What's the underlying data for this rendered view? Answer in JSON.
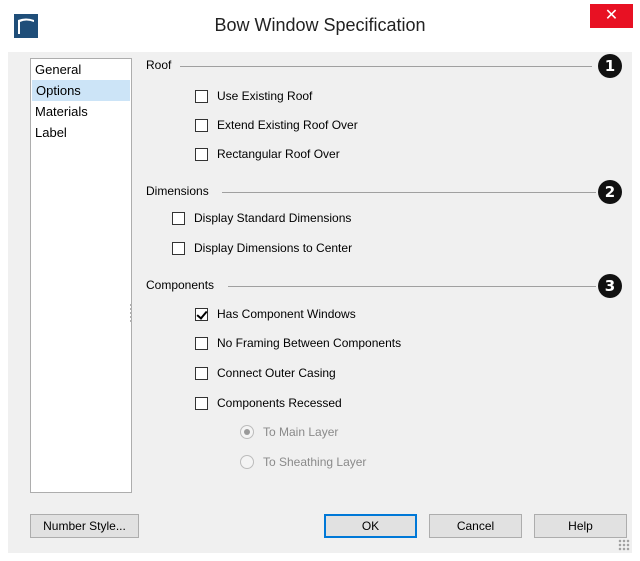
{
  "window": {
    "title": "Bow Window Specification",
    "close_glyph": "✕"
  },
  "nav": {
    "items": [
      {
        "label": "General",
        "selected": false
      },
      {
        "label": "Options",
        "selected": true
      },
      {
        "label": "Materials",
        "selected": false
      },
      {
        "label": "Label",
        "selected": false
      }
    ]
  },
  "sections": {
    "roof": {
      "label": "Roof",
      "badge": "1",
      "options": [
        {
          "label": "Use Existing Roof",
          "checked": false
        },
        {
          "label": "Extend Existing Roof Over",
          "checked": false
        },
        {
          "label": "Rectangular Roof Over",
          "checked": false
        }
      ]
    },
    "dimensions": {
      "label": "Dimensions",
      "badge": "2",
      "options": [
        {
          "label": "Display Standard Dimensions",
          "checked": false
        },
        {
          "label": "Display Dimensions to Center",
          "checked": false
        }
      ]
    },
    "components": {
      "label": "Components",
      "badge": "3",
      "options": [
        {
          "label": "Has Component Windows",
          "checked": true
        },
        {
          "label": "No Framing Between Components",
          "checked": false
        },
        {
          "label": "Connect Outer Casing",
          "checked": false
        },
        {
          "label": "Components Recessed",
          "checked": false
        }
      ],
      "radios": [
        {
          "label": "To Main Layer",
          "selected": true,
          "enabled": false
        },
        {
          "label": "To Sheathing Layer",
          "selected": false,
          "enabled": false
        }
      ]
    }
  },
  "buttons": {
    "number_style": "Number Style...",
    "ok": "OK",
    "cancel": "Cancel",
    "help": "Help"
  },
  "colors": {
    "close_red": "#e81123",
    "selection_blue": "#cce4f7",
    "default_button_border": "#0078d7",
    "badge_black": "#111111"
  }
}
